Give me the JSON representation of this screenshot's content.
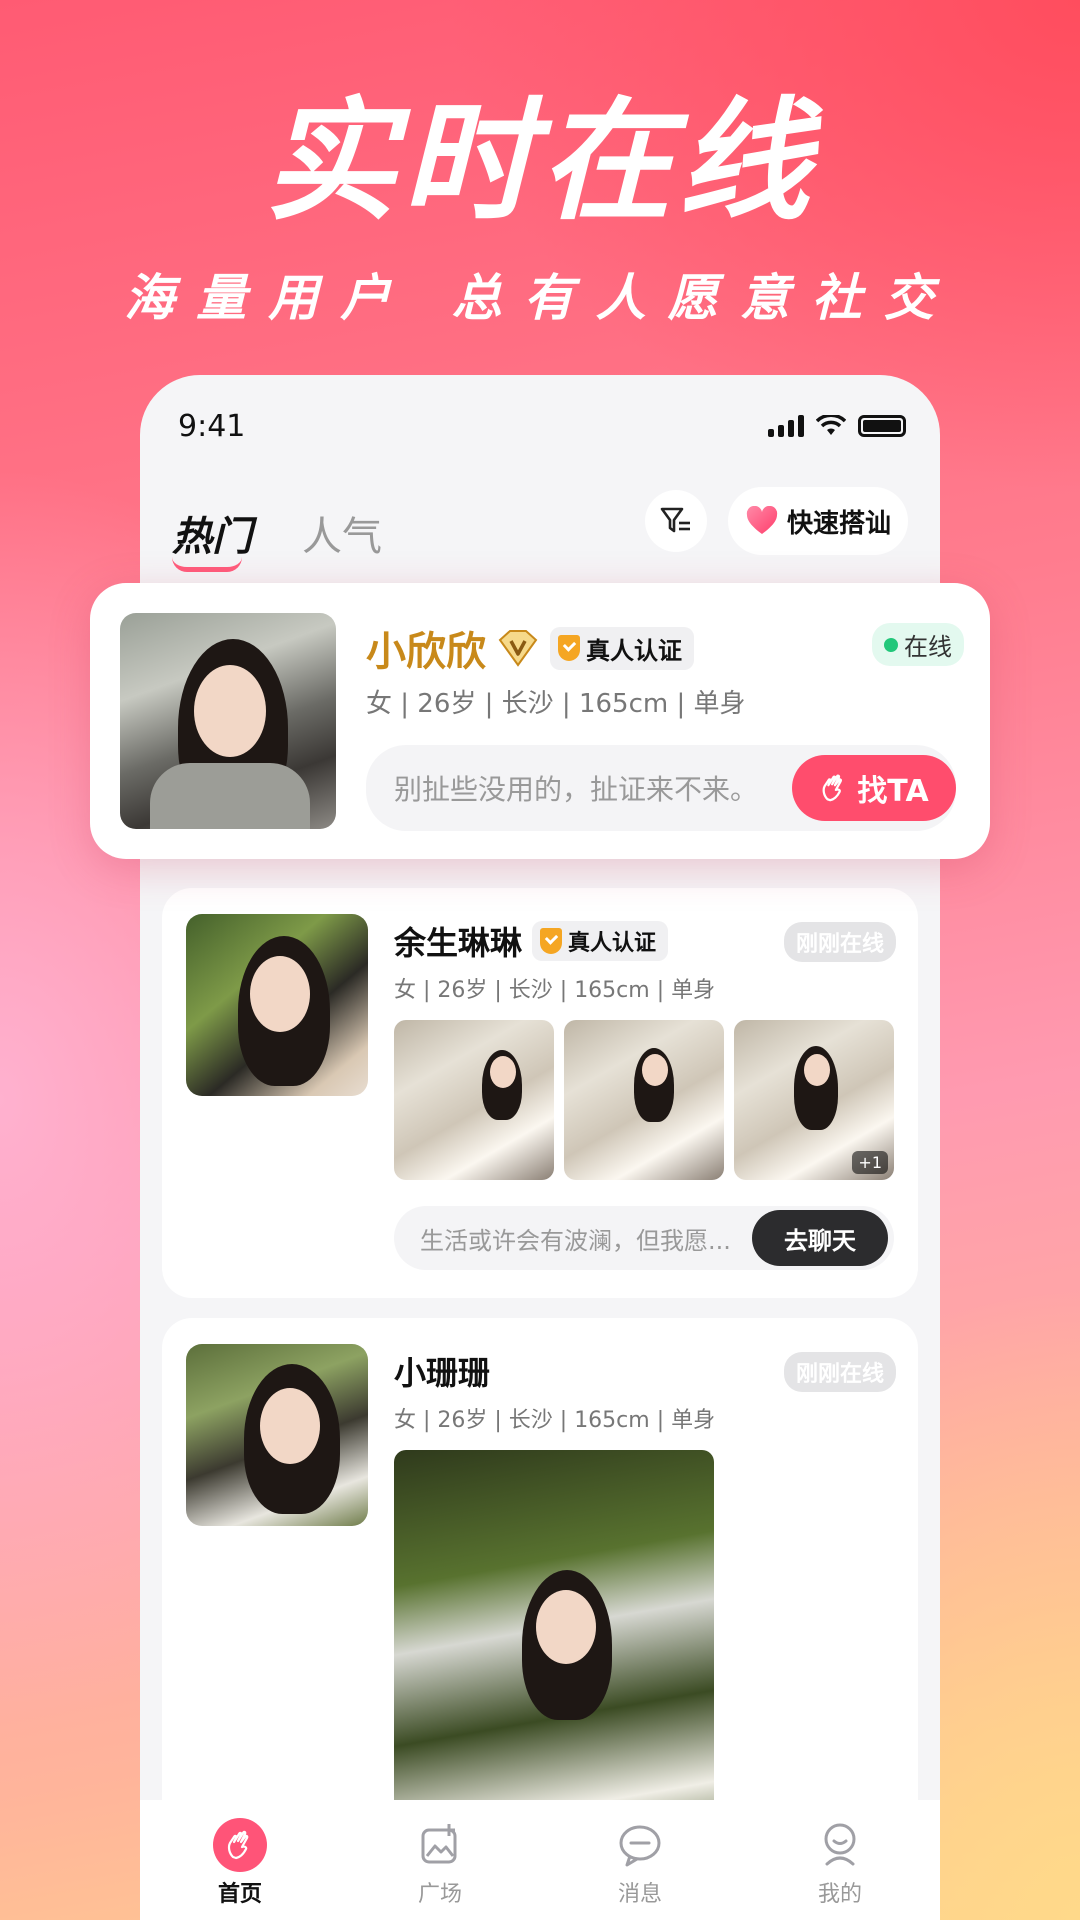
{
  "promo": {
    "headline": "实时在线",
    "subline": "海量用户 总有人愿意社交"
  },
  "status_bar": {
    "time": "9:41"
  },
  "top_tabs": [
    {
      "label": "热门",
      "active": true
    },
    {
      "label": "人气",
      "active": false
    }
  ],
  "quick_match": {
    "label": "快速搭讪",
    "icon": "heart-icon"
  },
  "filter": {
    "icon": "filter-icon"
  },
  "profiles": [
    {
      "name": "小欣欣",
      "vip_icon": "v-diamond-badge-icon",
      "verify_label": "真人认证",
      "status": "在线",
      "info": "女 | 26岁 | 长沙 | 165cm | 单身",
      "greeting": "别扯些没用的，扯证来不来。",
      "action": "找TA"
    },
    {
      "name": "余生琳琳",
      "verify_label": "真人认证",
      "status": "刚刚在线",
      "info": "女 | 26岁 | 长沙 | 165cm | 单身",
      "photo_more": "+1",
      "greeting": "生活或许会有波澜，但我愿...",
      "action": "去聊天"
    },
    {
      "name": "小珊珊",
      "status": "刚刚在线",
      "info": "女 | 26岁 | 长沙 | 165cm | 单身"
    }
  ],
  "bottom_tabs": [
    {
      "label": "首页",
      "icon": "wave-hand-icon",
      "active": true
    },
    {
      "label": "广场",
      "icon": "gallery-icon",
      "active": false
    },
    {
      "label": "消息",
      "icon": "chat-bubble-icon",
      "active": false
    },
    {
      "label": "我的",
      "icon": "profile-icon",
      "active": false
    }
  ],
  "colors": {
    "accent": "#ff4d6d",
    "online": "#22c77a",
    "gold_name": "#c8891a"
  }
}
